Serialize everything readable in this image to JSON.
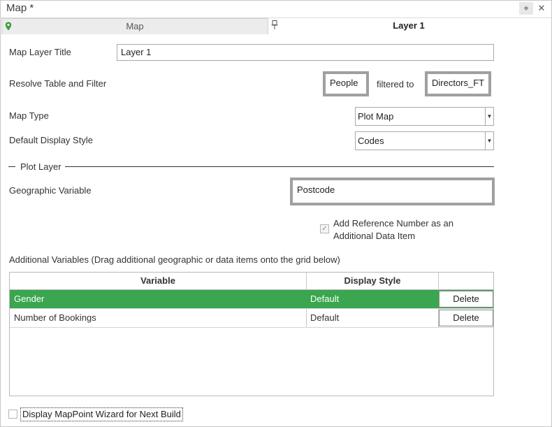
{
  "window": {
    "title": "Map *",
    "pin_glyph": "⌖",
    "close_glyph": "✕"
  },
  "tabs": [
    {
      "label": "Map",
      "icon": "map-marker-icon"
    },
    {
      "label": "Layer 1",
      "icon": "pin-icon"
    }
  ],
  "form": {
    "map_layer_title_label": "Map Layer Title",
    "map_layer_title_value": "Layer 1",
    "resolve_label": "Resolve Table and Filter",
    "resolve_table": "People",
    "filtered_to_label": "filtered to",
    "resolve_filter": "Directors_FT",
    "map_type_label": "Map Type",
    "map_type_value": "Plot Map",
    "default_display_style_label": "Default Display Style",
    "default_display_style_value": "Codes"
  },
  "plot_layer": {
    "section_title": "Plot Layer",
    "geo_variable_label": "Geographic Variable",
    "geo_variable_value": "Postcode",
    "add_ref_checkbox_label_1": "Add Reference Number as an",
    "add_ref_checkbox_label_2": "Additional Data Item",
    "add_ref_checked": true
  },
  "additional": {
    "caption": "Additional Variables (Drag additional geographic or data items onto the grid below)",
    "columns": [
      "Variable",
      "Display Style",
      ""
    ],
    "rows": [
      {
        "variable": "Gender",
        "display_style": "Default",
        "action": "Delete",
        "selected": true
      },
      {
        "variable": "Number of Bookings",
        "display_style": "Default",
        "action": "Delete",
        "selected": false
      }
    ]
  },
  "footer": {
    "wizard_label": "Display MapPoint Wizard for Next Build",
    "wizard_checked": false
  },
  "colors": {
    "selected_row": "#3aa64f",
    "marker": "#3a9d3a",
    "frame": "#a0a0a0"
  }
}
